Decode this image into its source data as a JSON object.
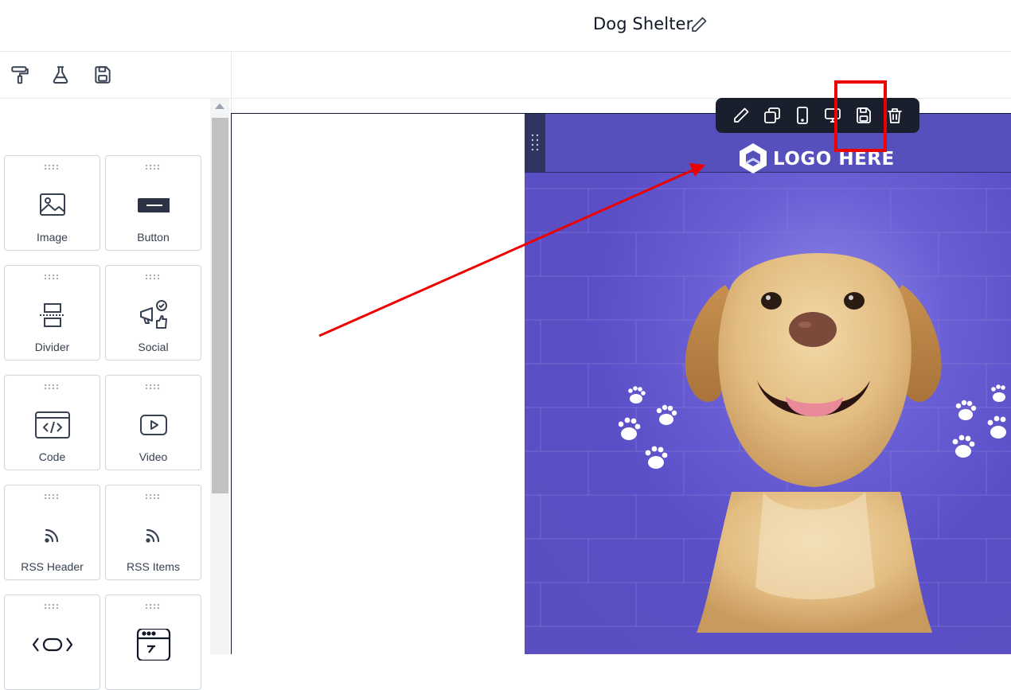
{
  "header": {
    "title": "Dog Shelter"
  },
  "toolbar": {
    "icons": [
      "paint-roller-icon",
      "flask-icon",
      "save-icon"
    ]
  },
  "sidebar": {
    "blocks": [
      {
        "label": "Image",
        "icon": "image-icon"
      },
      {
        "label": "Button",
        "icon": "button-icon"
      },
      {
        "label": "Divider",
        "icon": "divider-icon"
      },
      {
        "label": "Social",
        "icon": "social-icon"
      },
      {
        "label": "Code",
        "icon": "code-icon"
      },
      {
        "label": "Video",
        "icon": "video-icon"
      },
      {
        "label": "RSS Header",
        "icon": "rss-icon"
      },
      {
        "label": "RSS Items",
        "icon": "rss-icon"
      },
      {
        "label": "",
        "icon": "custom-html-icon"
      },
      {
        "label": "",
        "icon": "embed-icon"
      }
    ]
  },
  "canvas": {
    "logo_text": "LOGO HERE",
    "floating_toolbar": [
      "edit-icon",
      "duplicate-icon",
      "mobile-icon",
      "desktop-icon",
      "save-icon",
      "trash-icon"
    ]
  },
  "colors": {
    "accent_highlight": "#ef0000",
    "hero_background": "#5a4fc6",
    "toolbar_background": "#1a1f2e"
  }
}
